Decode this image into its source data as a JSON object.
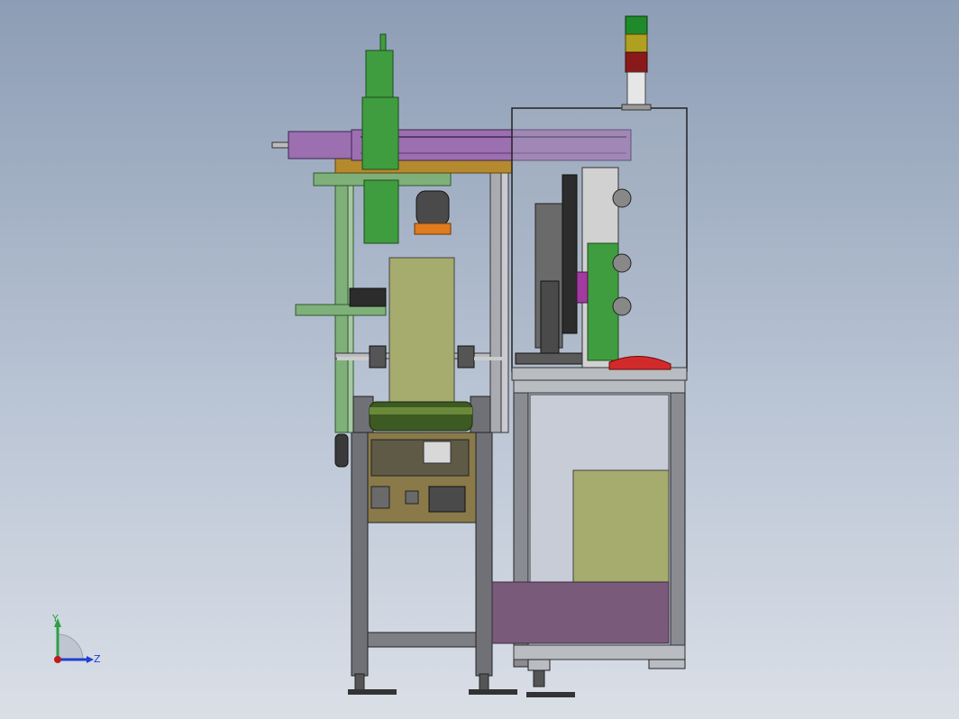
{
  "viewport": {
    "background_top": "#8d9db5",
    "background_bottom": "#dadfe7"
  },
  "triad": {
    "y_label": "Y",
    "z_label": "Z",
    "y_color": "#2ea043",
    "z_color": "#1f3fd1",
    "x_color": "#c21a1a"
  },
  "colors": {
    "frame_gray": "#7d7f84",
    "profile_green": "#7fb07a",
    "axis_purple": "#9b6fb0",
    "bracket_gold": "#b58a2e",
    "motor_green": "#3f9d3f",
    "panel_olive": "#a6ab6e",
    "drum_green": "#3d5a22",
    "base_purple": "#7a5a7a",
    "signal_green": "#1f8a2a",
    "signal_yellow": "#b0a020",
    "signal_red": "#8a1a1a",
    "gripper_orange": "#e07b1e"
  }
}
